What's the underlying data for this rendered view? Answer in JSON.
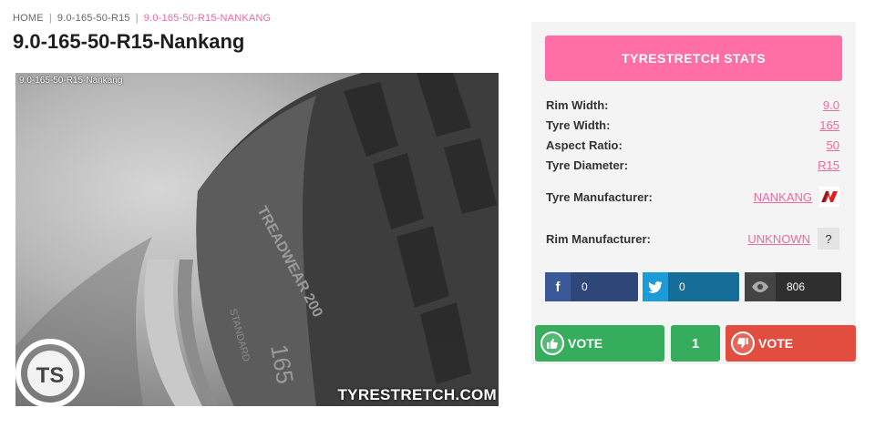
{
  "breadcrumb": {
    "home": "HOME",
    "parent": "9.0-165-50-R15",
    "current": "9.0-165-50-R15-NANKANG"
  },
  "page_title": "9.0-165-50-R15-Nankang",
  "photo": {
    "caption": "9.0-165-50-R15-Nankang",
    "watermark": "TYRESTRETCH.COM",
    "logo_text": "TS"
  },
  "stats": {
    "header": "TYRESTRETCH STATS",
    "rows": [
      {
        "label": "Rim Width:",
        "value": "9.0"
      },
      {
        "label": "Tyre Width:",
        "value": "165"
      },
      {
        "label": "Aspect Ratio:",
        "value": "50"
      },
      {
        "label": "Tyre Diameter:",
        "value": "R15"
      }
    ],
    "tyre_manufacturer": {
      "label": "Tyre Manufacturer:",
      "value": "NANKANG"
    },
    "rim_manufacturer": {
      "label": "Rim Manufacturer:",
      "value": "UNKNOWN",
      "badge": "?"
    }
  },
  "social": {
    "facebook_count": "0",
    "twitter_count": "0",
    "views_count": "806"
  },
  "votes": {
    "up_label": "VOTE",
    "count": "1",
    "down_label": "VOTE"
  },
  "colors": {
    "accent_pink": "#ff6fa5",
    "link_pink": "#ef6a9c",
    "vote_green": "#35ad5c",
    "vote_red": "#e14d3f",
    "facebook": "#3b5998",
    "twitter": "#1d9ad8"
  },
  "icons": [
    "facebook-icon",
    "twitter-icon",
    "eye-icon",
    "thumbs-up-icon",
    "thumbs-down-icon",
    "nankang-logo"
  ]
}
